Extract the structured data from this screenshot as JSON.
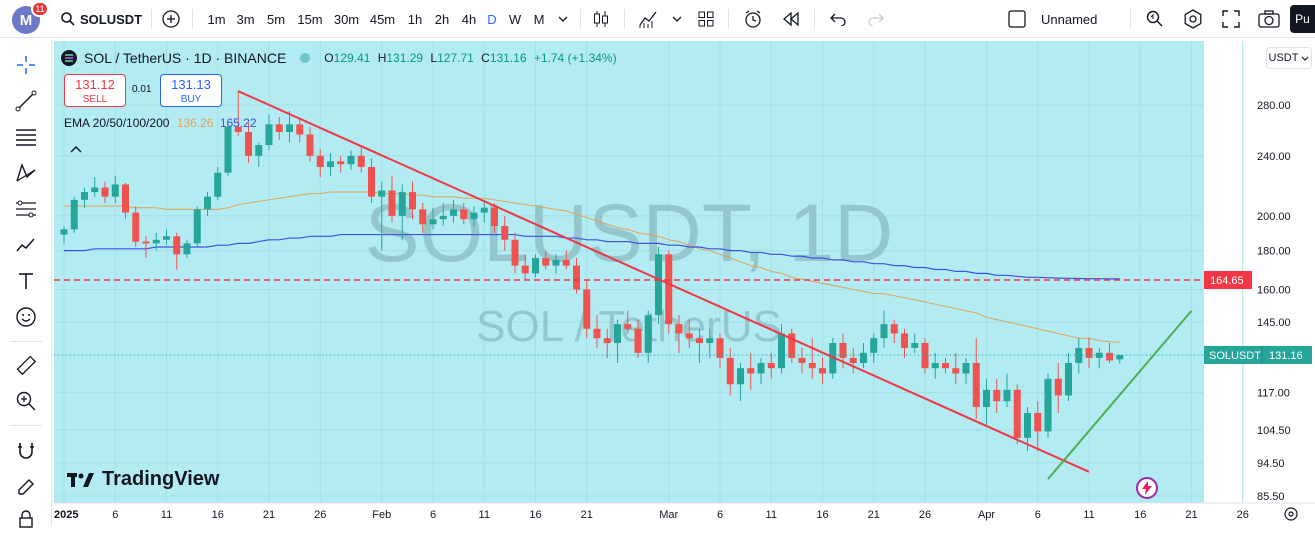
{
  "topbar": {
    "avatar_letter": "M",
    "notification_count": "11",
    "symbol": "SOLUSDT",
    "intervals": [
      "1m",
      "3m",
      "5m",
      "15m",
      "30m",
      "45m",
      "1h",
      "2h",
      "4h",
      "D",
      "W",
      "M"
    ],
    "active_interval": "D",
    "layout_name": "Unnamed",
    "publish_label": "Pu"
  },
  "legend": {
    "title": "SOL / TetherUS · 1D · BINANCE",
    "open_label": "O",
    "open": "129.41",
    "high_label": "H",
    "high": "131.29",
    "low_label": "L",
    "low": "127.71",
    "close_label": "C",
    "close": "131.16",
    "change": "+1.74 (+1.34%)",
    "sell_price": "131.12",
    "sell_label": "SELL",
    "spread": "0.01",
    "buy_price": "131.13",
    "buy_label": "BUY",
    "ema_label": "EMA 20/50/100/200",
    "ema_50": "136.26",
    "ema_100": "165.22"
  },
  "watermark": {
    "symbol": "SOLUSDT, 1D",
    "name": "SOL / TetherUS"
  },
  "brand": "TradingView",
  "price_axis": {
    "currency": "USDT",
    "ticks": [
      "280.00",
      "240.00",
      "200.00",
      "180.00",
      "160.00",
      "145.00",
      "131.00",
      "117.00",
      "104.50",
      "94.50",
      "85.50"
    ],
    "hline_label": "164.65",
    "last_symbol": "SOLUSDT",
    "last_price": "131.16"
  },
  "time_axis": {
    "ticks": [
      "2025",
      "6",
      "11",
      "16",
      "21",
      "26",
      "Feb",
      "6",
      "11",
      "16",
      "21",
      "Mar",
      "6",
      "11",
      "16",
      "21",
      "26",
      "Apr",
      "6",
      "11",
      "16",
      "21",
      "26"
    ]
  },
  "colors": {
    "background": "#b2ebf2",
    "up": "#26a69a",
    "down": "#ef5350",
    "trendline_down": "#f23645",
    "trendline_up": "#4caf50",
    "ema_50": "#e0a458",
    "ema_100": "#3f51e0",
    "hline": "#f23645"
  },
  "chart_data": {
    "type": "candlestick",
    "title": "SOL / TetherUS · 1D · BINANCE",
    "x": [
      "Jan 1",
      "Jan 2",
      "Jan 3",
      "Jan 4",
      "Jan 5",
      "Jan 6",
      "Jan 7",
      "Jan 8",
      "Jan 9",
      "Jan 10",
      "Jan 11",
      "Jan 12",
      "Jan 13",
      "Jan 14",
      "Jan 15",
      "Jan 16",
      "Jan 17",
      "Jan 18",
      "Jan 19",
      "Jan 20",
      "Jan 21",
      "Jan 22",
      "Jan 23",
      "Jan 24",
      "Jan 25",
      "Jan 26",
      "Jan 27",
      "Jan 28",
      "Jan 29",
      "Jan 30",
      "Jan 31",
      "Feb 1",
      "Feb 2",
      "Feb 3",
      "Feb 4",
      "Feb 5",
      "Feb 6",
      "Feb 7",
      "Feb 8",
      "Feb 9",
      "Feb 10",
      "Feb 11",
      "Feb 12",
      "Feb 13",
      "Feb 14",
      "Feb 15",
      "Feb 16",
      "Feb 17",
      "Feb 18",
      "Feb 19",
      "Feb 20",
      "Feb 21",
      "Feb 22",
      "Feb 23",
      "Feb 24",
      "Feb 25",
      "Feb 26",
      "Feb 27",
      "Feb 28",
      "Mar 1",
      "Mar 2",
      "Mar 3",
      "Mar 4",
      "Mar 5",
      "Mar 6",
      "Mar 7",
      "Mar 8",
      "Mar 9",
      "Mar 10",
      "Mar 11",
      "Mar 12",
      "Mar 13",
      "Mar 14",
      "Mar 15",
      "Mar 16",
      "Mar 17",
      "Mar 18",
      "Mar 19",
      "Mar 20",
      "Mar 21",
      "Mar 22",
      "Mar 23",
      "Mar 24",
      "Mar 25",
      "Mar 26",
      "Mar 27",
      "Mar 28",
      "Mar 29",
      "Mar 30",
      "Mar 31",
      "Apr 1",
      "Apr 2",
      "Apr 3",
      "Apr 4",
      "Apr 5",
      "Apr 6",
      "Apr 7",
      "Apr 8",
      "Apr 9",
      "Apr 10",
      "Apr 11",
      "Apr 12",
      "Apr 13",
      "Apr 14"
    ],
    "ohlc": [
      [
        189,
        194,
        184,
        192
      ],
      [
        192,
        212,
        190,
        210
      ],
      [
        210,
        218,
        205,
        215
      ],
      [
        215,
        225,
        212,
        218
      ],
      [
        218,
        222,
        208,
        212
      ],
      [
        212,
        226,
        208,
        220
      ],
      [
        220,
        221,
        198,
        202
      ],
      [
        202,
        206,
        182,
        185
      ],
      [
        185,
        188,
        176,
        184
      ],
      [
        184,
        190,
        180,
        186
      ],
      [
        186,
        192,
        183,
        188
      ],
      [
        188,
        190,
        170,
        178
      ],
      [
        178,
        186,
        176,
        184
      ],
      [
        184,
        206,
        182,
        204
      ],
      [
        204,
        215,
        200,
        212
      ],
      [
        212,
        232,
        210,
        228
      ],
      [
        228,
        265,
        226,
        262
      ],
      [
        262,
        292,
        255,
        258
      ],
      [
        258,
        265,
        235,
        240
      ],
      [
        240,
        250,
        232,
        248
      ],
      [
        248,
        272,
        244,
        264
      ],
      [
        264,
        270,
        252,
        258
      ],
      [
        258,
        275,
        250,
        264
      ],
      [
        264,
        268,
        250,
        256
      ],
      [
        256,
        262,
        236,
        240
      ],
      [
        240,
        245,
        225,
        232
      ],
      [
        232,
        242,
        226,
        236
      ],
      [
        236,
        240,
        228,
        234
      ],
      [
        234,
        244,
        230,
        240
      ],
      [
        240,
        246,
        228,
        232
      ],
      [
        232,
        238,
        208,
        212
      ],
      [
        212,
        222,
        180,
        216
      ],
      [
        216,
        226,
        196,
        200
      ],
      [
        200,
        220,
        186,
        215
      ],
      [
        215,
        222,
        198,
        204
      ],
      [
        204,
        208,
        190,
        195
      ],
      [
        195,
        205,
        192,
        198
      ],
      [
        198,
        208,
        194,
        200
      ],
      [
        200,
        210,
        196,
        204
      ],
      [
        204,
        208,
        195,
        198
      ],
      [
        198,
        206,
        194,
        202
      ],
      [
        202,
        210,
        196,
        205
      ],
      [
        205,
        208,
        190,
        194
      ],
      [
        194,
        200,
        180,
        186
      ],
      [
        186,
        190,
        168,
        172
      ],
      [
        172,
        178,
        165,
        168
      ],
      [
        168,
        178,
        166,
        176
      ],
      [
        176,
        180,
        170,
        172
      ],
      [
        172,
        178,
        168,
        175
      ],
      [
        175,
        180,
        170,
        172
      ],
      [
        172,
        176,
        158,
        160
      ],
      [
        160,
        164,
        138,
        142
      ],
      [
        142,
        148,
        134,
        138
      ],
      [
        138,
        142,
        130,
        136
      ],
      [
        136,
        146,
        128,
        144
      ],
      [
        144,
        150,
        140,
        142
      ],
      [
        142,
        146,
        130,
        132
      ],
      [
        132,
        150,
        128,
        148
      ],
      [
        148,
        182,
        144,
        178
      ],
      [
        178,
        180,
        140,
        144
      ],
      [
        144,
        148,
        132,
        140
      ],
      [
        140,
        146,
        134,
        138
      ],
      [
        138,
        142,
        128,
        136
      ],
      [
        136,
        142,
        130,
        138
      ],
      [
        138,
        140,
        126,
        130
      ],
      [
        130,
        134,
        116,
        120
      ],
      [
        120,
        128,
        114,
        126
      ],
      [
        126,
        132,
        118,
        124
      ],
      [
        124,
        130,
        120,
        128
      ],
      [
        128,
        132,
        122,
        126
      ],
      [
        126,
        144,
        124,
        140
      ],
      [
        140,
        142,
        128,
        130
      ],
      [
        130,
        134,
        124,
        128
      ],
      [
        128,
        138,
        122,
        126
      ],
      [
        126,
        130,
        120,
        124
      ],
      [
        124,
        138,
        122,
        136
      ],
      [
        136,
        140,
        126,
        130
      ],
      [
        130,
        134,
        124,
        128
      ],
      [
        128,
        136,
        126,
        132
      ],
      [
        132,
        140,
        128,
        138
      ],
      [
        138,
        150,
        134,
        144
      ],
      [
        144,
        146,
        136,
        140
      ],
      [
        140,
        142,
        130,
        134
      ],
      [
        134,
        140,
        132,
        136
      ],
      [
        136,
        138,
        124,
        126
      ],
      [
        126,
        132,
        122,
        128
      ],
      [
        128,
        130,
        124,
        126
      ],
      [
        126,
        132,
        120,
        124
      ],
      [
        124,
        130,
        120,
        128
      ],
      [
        128,
        138,
        108,
        112
      ],
      [
        112,
        122,
        106,
        118
      ],
      [
        118,
        122,
        110,
        114
      ],
      [
        114,
        124,
        112,
        118
      ],
      [
        118,
        120,
        100,
        102
      ],
      [
        102,
        112,
        98,
        110
      ],
      [
        110,
        114,
        98,
        104
      ],
      [
        104,
        124,
        102,
        122
      ],
      [
        122,
        128,
        110,
        116
      ],
      [
        116,
        132,
        114,
        128
      ],
      [
        128,
        138,
        124,
        134
      ],
      [
        134,
        138,
        126,
        130
      ],
      [
        130,
        134,
        126,
        132
      ],
      [
        132,
        136,
        128,
        129
      ],
      [
        129.41,
        131.29,
        127.71,
        131.16
      ]
    ],
    "ema_50": [
      206,
      206,
      206,
      206,
      206,
      206,
      206,
      205,
      205,
      205,
      204,
      204,
      204,
      204,
      204,
      204,
      205,
      207,
      208,
      209,
      210,
      211,
      212,
      213,
      214,
      214,
      215,
      215,
      215,
      215,
      215,
      214,
      214,
      214,
      213,
      213,
      212,
      212,
      212,
      211,
      211,
      211,
      210,
      209,
      208,
      207,
      206,
      205,
      204,
      203,
      201,
      199,
      197,
      195,
      193,
      192,
      190,
      189,
      188,
      186,
      185,
      183,
      181,
      180,
      178,
      176,
      174,
      172,
      171,
      169,
      168,
      166,
      165,
      164,
      163,
      162,
      161,
      160,
      159,
      158,
      158,
      157,
      156,
      155,
      154,
      153,
      152,
      151,
      150,
      149,
      147,
      146,
      145,
      144,
      143,
      142,
      141,
      140,
      139,
      138,
      138,
      137,
      136.5,
      136.26
    ],
    "ema_100": [
      180,
      180,
      180,
      181,
      181,
      181,
      181,
      181,
      181,
      182,
      182,
      182,
      182,
      182,
      182,
      183,
      183,
      184,
      184,
      185,
      186,
      186,
      187,
      187,
      188,
      188,
      188,
      189,
      189,
      189,
      189,
      189,
      189,
      189,
      189,
      189,
      189,
      189,
      189,
      189,
      189,
      189,
      189,
      189,
      189,
      188,
      188,
      188,
      188,
      187,
      187,
      186,
      186,
      185,
      185,
      185,
      184,
      184,
      184,
      183,
      183,
      182,
      182,
      181,
      181,
      180,
      180,
      179,
      179,
      178,
      178,
      177,
      177,
      176,
      176,
      175,
      175,
      174,
      174,
      173,
      173,
      172,
      172,
      171,
      171,
      170,
      170,
      169,
      169,
      168,
      168,
      167,
      167,
      166.5,
      166,
      166,
      165.8,
      165.6,
      165.5,
      165.4,
      165.3,
      165.3,
      165.22,
      165.22
    ],
    "horizontal_line": 164.65,
    "trendlines": [
      {
        "from": [
          "Jan 18",
          292
        ],
        "to": [
          "Apr 11",
          92
        ]
      },
      {
        "from": [
          "Apr 7",
          90
        ],
        "to": [
          "Apr 21",
          150
        ]
      }
    ],
    "ylabel": "",
    "y_scale": "log",
    "grid": true
  }
}
